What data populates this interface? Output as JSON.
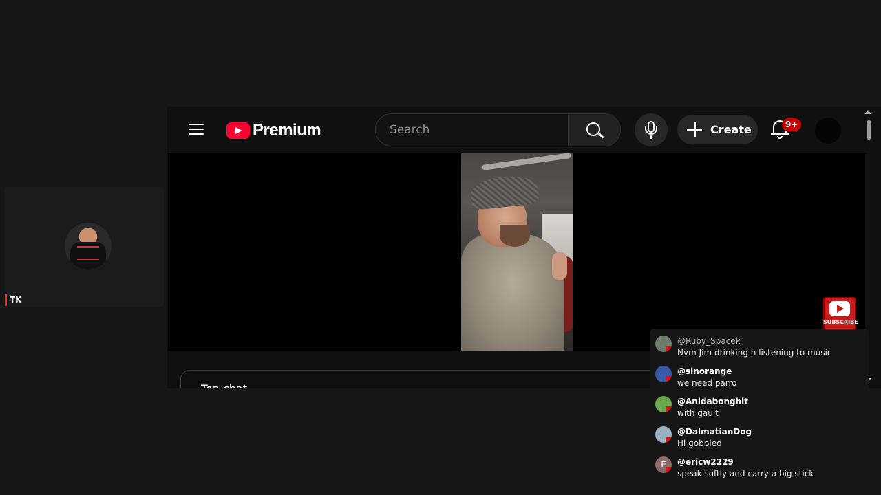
{
  "participant_tile": {
    "name": "TK"
  },
  "youtube": {
    "brand": "Premium",
    "search": {
      "placeholder": "Search"
    },
    "create_label": "Create",
    "notifications_badge": "9+",
    "subscribe_label": "SUBSCRIBE",
    "chat_panel_title": "Top chat",
    "colors": {
      "brand_red": "#ff0033",
      "badge_red": "#cc0000",
      "background": "#0f0f0f"
    }
  },
  "chat_overlay": {
    "messages": [
      {
        "user": "@Ruby_Spacek",
        "text": "Nvm Jim drinking n listening to music",
        "avatar_color": "#6e7a6b"
      },
      {
        "user": "@sinorange",
        "text": "we need parro",
        "avatar_color": "#3a5aa8"
      },
      {
        "user": "@Anidabonghit",
        "text": "with gault",
        "avatar_color": "#6aa84f"
      },
      {
        "user": "@DalmatianDog",
        "text": "Hi gobbled",
        "avatar_color": "#9ab0c0"
      },
      {
        "user": "@ericw2229",
        "text": "speak softly and carry a big stick",
        "avatar_color": "#8a6a6a",
        "avatar_letter": "E"
      }
    ]
  }
}
